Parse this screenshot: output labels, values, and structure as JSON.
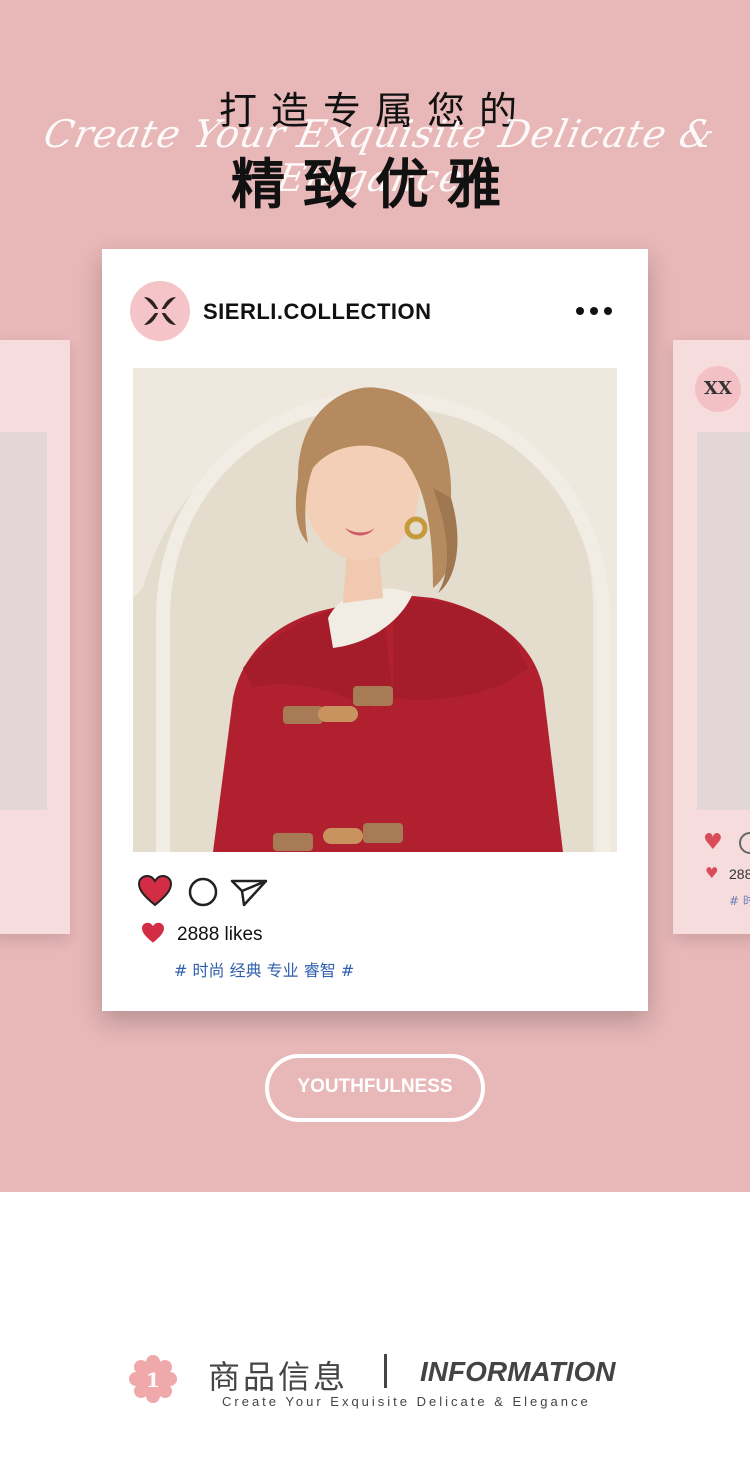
{
  "hero": {
    "title_line1": "打造专属您的",
    "script_text": "Create Your Exquisite Delicate & Elegance",
    "title_line2": "精致优雅",
    "background": "#e8b7b8"
  },
  "post": {
    "account": "SIERLI.COLLECTION",
    "logo_glyph": "XX",
    "likes": "2888 likes",
    "hashtags": "# 时尚 经典 专业 睿智 #",
    "heart_color": "#d22d44",
    "hashtag_color": "#2f5fad",
    "icons": [
      "heart-icon",
      "comment-icon",
      "share-icon",
      "more-icon"
    ]
  },
  "side_cards": {
    "right_likes": "288",
    "right_tag": "# 时"
  },
  "badge_button": {
    "label": "YOUTHFULNESS"
  },
  "info": {
    "number": "1",
    "title_cn": "商品信息",
    "title_en": "INFORMATION",
    "subtitle": "Create Your Exquisite Delicate & Elegance"
  }
}
